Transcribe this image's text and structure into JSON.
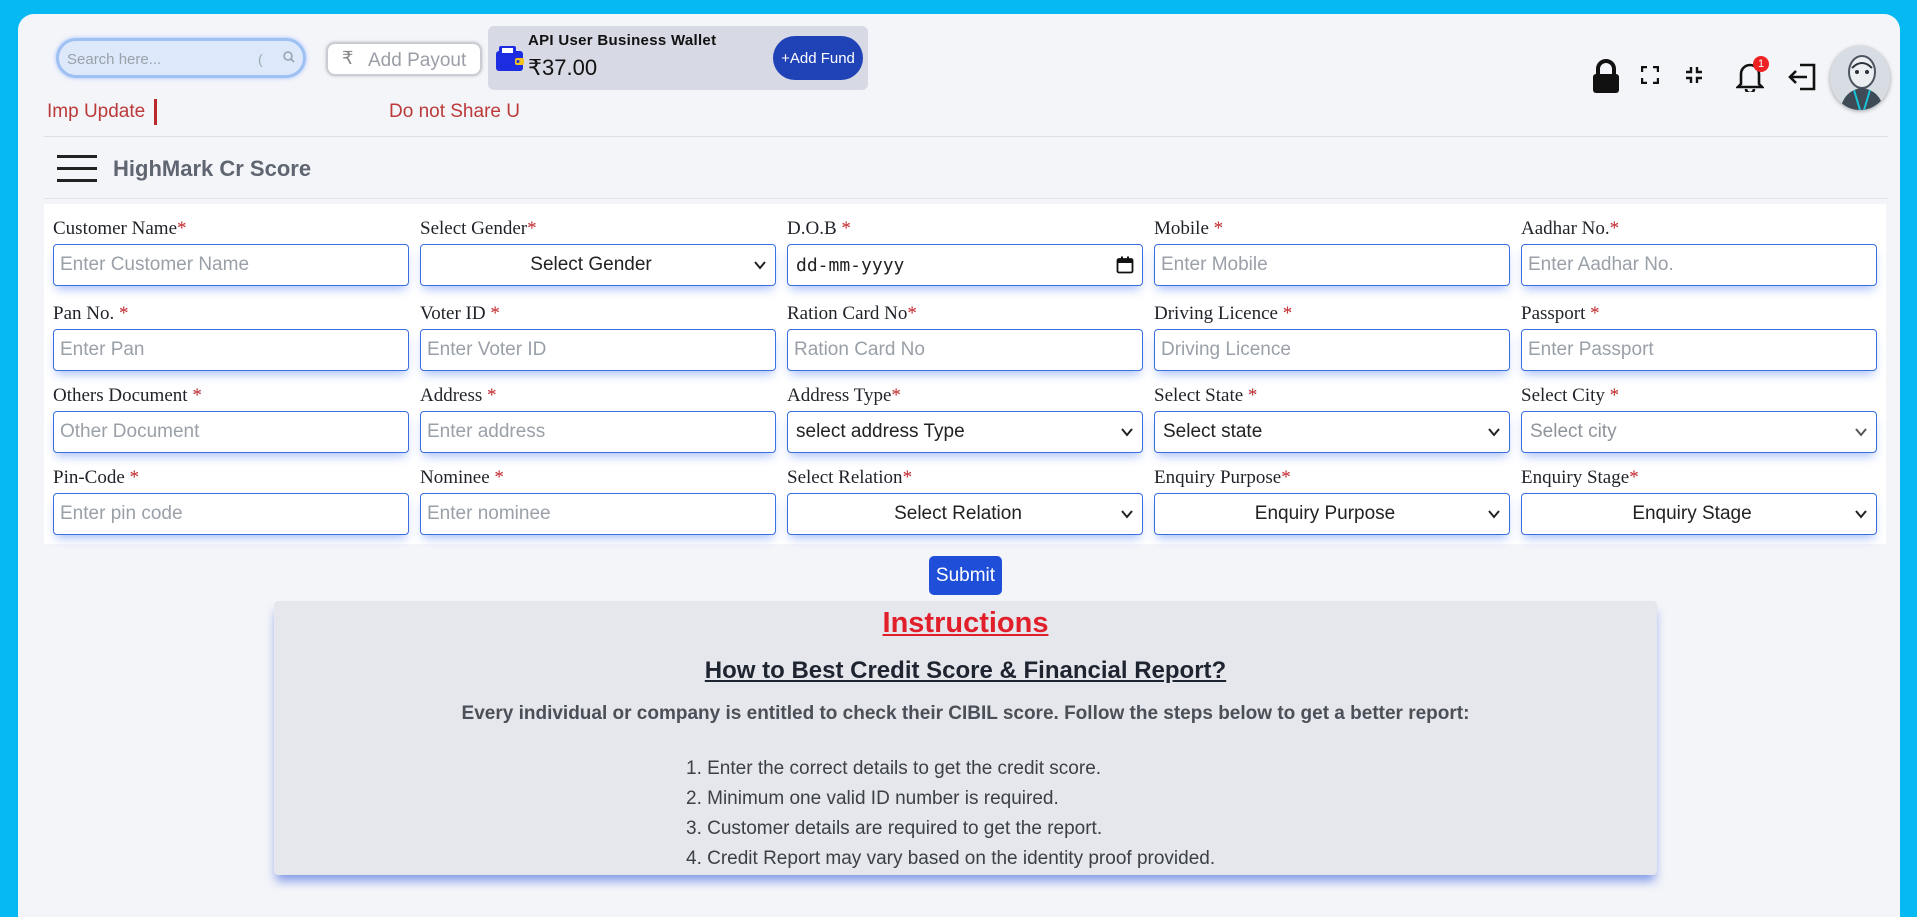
{
  "topbar": {
    "search_placeholder": "Search here...",
    "search_sep": "(",
    "payout_symbol": "₹",
    "payout_label": "Add Payout",
    "wallet_title": "API User Business Wallet",
    "wallet_balance": "₹37.00",
    "add_fund_label": "+Add Fund",
    "notification_count": "1",
    "ticker_left": "Imp Update",
    "ticker_right": "Do not Share U"
  },
  "page": {
    "title": "HighMark Cr Score"
  },
  "form": {
    "customer_name": {
      "label": "Customer Name",
      "req": "*",
      "placeholder": "Enter Customer Name"
    },
    "gender": {
      "label": "Select Gender",
      "req": "*",
      "value": "Select Gender"
    },
    "dob": {
      "label": "D.O.B ",
      "req": "*",
      "value": "dd-mm-yyyy"
    },
    "mobile": {
      "label": "Mobile ",
      "req": "*",
      "placeholder": "Enter Mobile"
    },
    "aadhar": {
      "label": "Aadhar No.",
      "req": "*",
      "placeholder": "Enter Aadhar No."
    },
    "pan": {
      "label": "Pan No. ",
      "req": "*",
      "placeholder": "Enter Pan"
    },
    "voter": {
      "label": "Voter ID ",
      "req": "*",
      "placeholder": "Enter Voter ID"
    },
    "ration": {
      "label": "Ration Card No",
      "req": "*",
      "placeholder": "Ration Card No"
    },
    "driving": {
      "label": "Driving Licence ",
      "req": "*",
      "placeholder": "Driving Licence"
    },
    "passport": {
      "label": "Passport ",
      "req": "*",
      "placeholder": "Enter Passport"
    },
    "others": {
      "label": "Others Document ",
      "req": "*",
      "placeholder": "Other Document"
    },
    "address": {
      "label": "Address ",
      "req": "*",
      "placeholder": "Enter address"
    },
    "address_type": {
      "label": "Address Type",
      "req": "*",
      "value": "select address Type"
    },
    "state": {
      "label": "Select State ",
      "req": "*",
      "value": "Select state"
    },
    "city": {
      "label": "Select City ",
      "req": "*",
      "value": "Select city"
    },
    "pincode": {
      "label": "Pin-Code ",
      "req": "*",
      "placeholder": "Enter pin code"
    },
    "nominee": {
      "label": "Nominee ",
      "req": "*",
      "placeholder": "Enter nominee"
    },
    "relation": {
      "label": "Select Relation",
      "req": "*",
      "value": "Select Relation"
    },
    "purpose": {
      "label": "Enquiry Purpose",
      "req": "*",
      "value": "Enquiry Purpose"
    },
    "stage": {
      "label": "Enquiry Stage",
      "req": "*",
      "value": "Enquiry Stage"
    },
    "submit_label": "Submit"
  },
  "instructions": {
    "heading": "Instructions",
    "subheading": "How to Best Credit Score & Financial Report?",
    "lead": "Every individual or company is entitled to check their CIBIL score. Follow the steps below to get a better report:",
    "steps": [
      "1. Enter the correct details to get the credit score.",
      "2. Minimum one valid ID number is required.",
      "3. Customer details are required to get the report.",
      "4. Credit Report may vary based on the identity proof provided."
    ]
  },
  "colors": {
    "page_bg": "#07b9f2",
    "primary": "#1f4fd8",
    "required": "#c0282d",
    "heading_red": "#e11f2b"
  }
}
